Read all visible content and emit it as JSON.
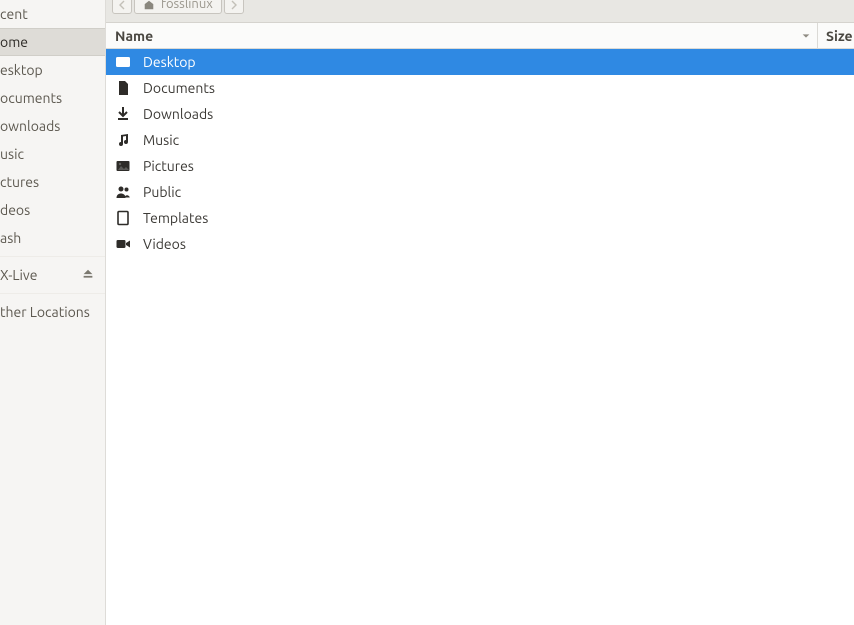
{
  "pathbar": {
    "location": "fosslinux"
  },
  "sidebar": {
    "items": [
      {
        "label": "cent"
      },
      {
        "label": "ome"
      },
      {
        "label": "esktop"
      },
      {
        "label": "ocuments"
      },
      {
        "label": "ownloads"
      },
      {
        "label": "usic"
      },
      {
        "label": "ctures"
      },
      {
        "label": "deos"
      },
      {
        "label": "ash"
      }
    ],
    "mount": {
      "label": "X-Live"
    },
    "other": {
      "label": "ther Locations"
    }
  },
  "columns": {
    "name": "Name",
    "size": "Size"
  },
  "files": [
    {
      "icon": "folder-desktop",
      "name": "Desktop"
    },
    {
      "icon": "doc",
      "name": "Documents"
    },
    {
      "icon": "download",
      "name": "Downloads"
    },
    {
      "icon": "music",
      "name": "Music"
    },
    {
      "icon": "picture",
      "name": "Pictures"
    },
    {
      "icon": "people",
      "name": "Public"
    },
    {
      "icon": "template",
      "name": "Templates"
    },
    {
      "icon": "video",
      "name": "Videos"
    }
  ]
}
